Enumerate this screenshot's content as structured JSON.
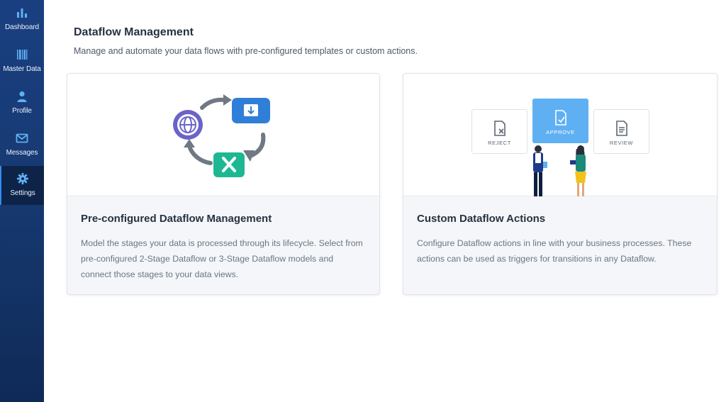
{
  "sidebar": {
    "items": [
      {
        "label": "Dashboard",
        "icon": "bar-chart-icon"
      },
      {
        "label": "Master Data",
        "icon": "barcode-icon"
      },
      {
        "label": "Profile",
        "icon": "user-icon"
      },
      {
        "label": "Messages",
        "icon": "mail-icon"
      },
      {
        "label": "Settings",
        "icon": "gear-icon",
        "active": true
      }
    ]
  },
  "header": {
    "title": "Dataflow Management",
    "subtitle": "Manage and automate your data flows with pre-configured templates or custom actions."
  },
  "cards": [
    {
      "title": "Pre-configured Dataflow Management",
      "description": "Model the stages your data is processed through its lifecycle. Select from pre-configured 2-Stage Dataflow or 3-Stage Dataflow models and connect those stages to your data views."
    },
    {
      "title": "Custom Dataflow Actions",
      "description": "Configure Dataflow actions in line with your business processes. These actions can be used as triggers for transitions in any Dataflow.",
      "actions": [
        "REJECT",
        "APPROVE",
        "REVIEW"
      ]
    }
  ],
  "colors": {
    "sidebar": "#173a73",
    "accent": "#2f8cf0",
    "approve": "#5fb0f3",
    "globe": "#6a63c9",
    "download": "#2f7fd8",
    "tools": "#1db892"
  }
}
